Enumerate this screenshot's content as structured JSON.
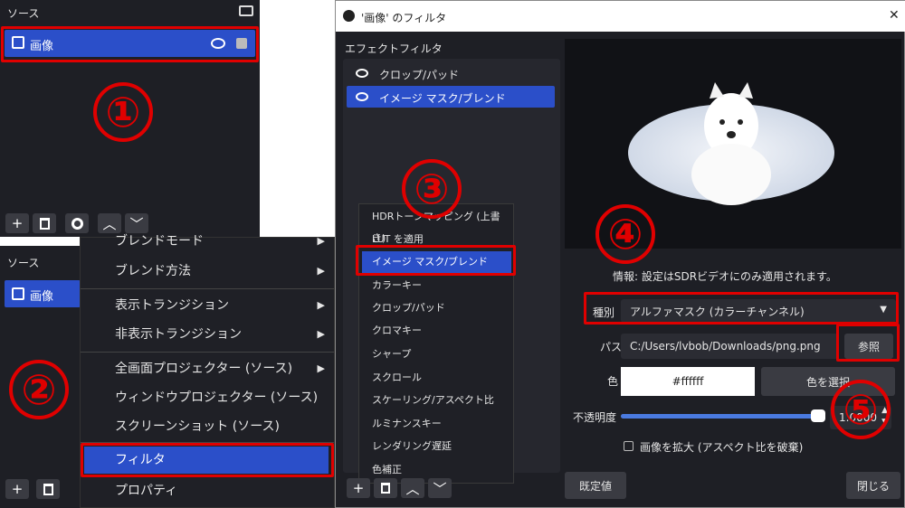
{
  "source_panel_top": {
    "title": "ソース",
    "item_label": "画像",
    "buttons": [
      "+",
      "🗑",
      "⚙",
      "∧",
      "∨"
    ]
  },
  "source_panel_bottom": {
    "title": "ソース",
    "item_label": "画像"
  },
  "context_menu": {
    "items": [
      {
        "label": "ブレンドモード",
        "submenu": true
      },
      {
        "label": "ブレンド方法",
        "submenu": true
      },
      {
        "label": "表示トランジション",
        "submenu": true
      },
      {
        "label": "非表示トランジション",
        "submenu": true
      },
      {
        "label": "全画面プロジェクター (ソース)",
        "submenu": true
      },
      {
        "label": "ウィンドウプロジェクター (ソース)",
        "submenu": false
      },
      {
        "label": "スクリーンショット (ソース)",
        "submenu": false
      },
      {
        "label": "フィルタ",
        "submenu": false
      },
      {
        "label": "プロパティ",
        "submenu": false
      }
    ]
  },
  "filter_window": {
    "title": "'画像' のフィルタ",
    "close": "✕",
    "effect_filter_label": "エフェクトフィルタ",
    "filters": [
      "クロップ/パッド",
      "イメージ マスク/ブレンド"
    ],
    "add_menu": [
      "HDRトーンマッピング (上書き)",
      "LUT を適用",
      "イメージ マスク/ブレンド",
      "カラーキー",
      "クロップ/パッド",
      "クロマキー",
      "シャープ",
      "スクロール",
      "スケーリング/アスペクト比",
      "ルミナンスキー",
      "レンダリング遅延",
      "色補正"
    ],
    "info_text": "情報: 設定はSDRビデオにのみ適用されます。",
    "type_label": "種別",
    "type_value": "アルファマスク (カラーチャンネル)",
    "path_label": "パス",
    "path_value": "C:/Users/lvbob/Downloads/png.png",
    "browse_button": "参照",
    "color_label": "色",
    "color_value": "#ffffff",
    "select_color_button": "色を選択",
    "opacity_label": "不透明度",
    "opacity_value": "1.0000",
    "opacity_fraction": 1.0,
    "stretch_label": "画像を拡大 (アスペクト比を破棄)",
    "defaults_button": "既定値",
    "close_button": "閉じる"
  },
  "annotations": [
    "①",
    "②",
    "③",
    "④",
    "⑤"
  ],
  "colors": {
    "selected": "#2b4fc9",
    "annotation": "#e00000",
    "panel": "#1e1f25"
  }
}
